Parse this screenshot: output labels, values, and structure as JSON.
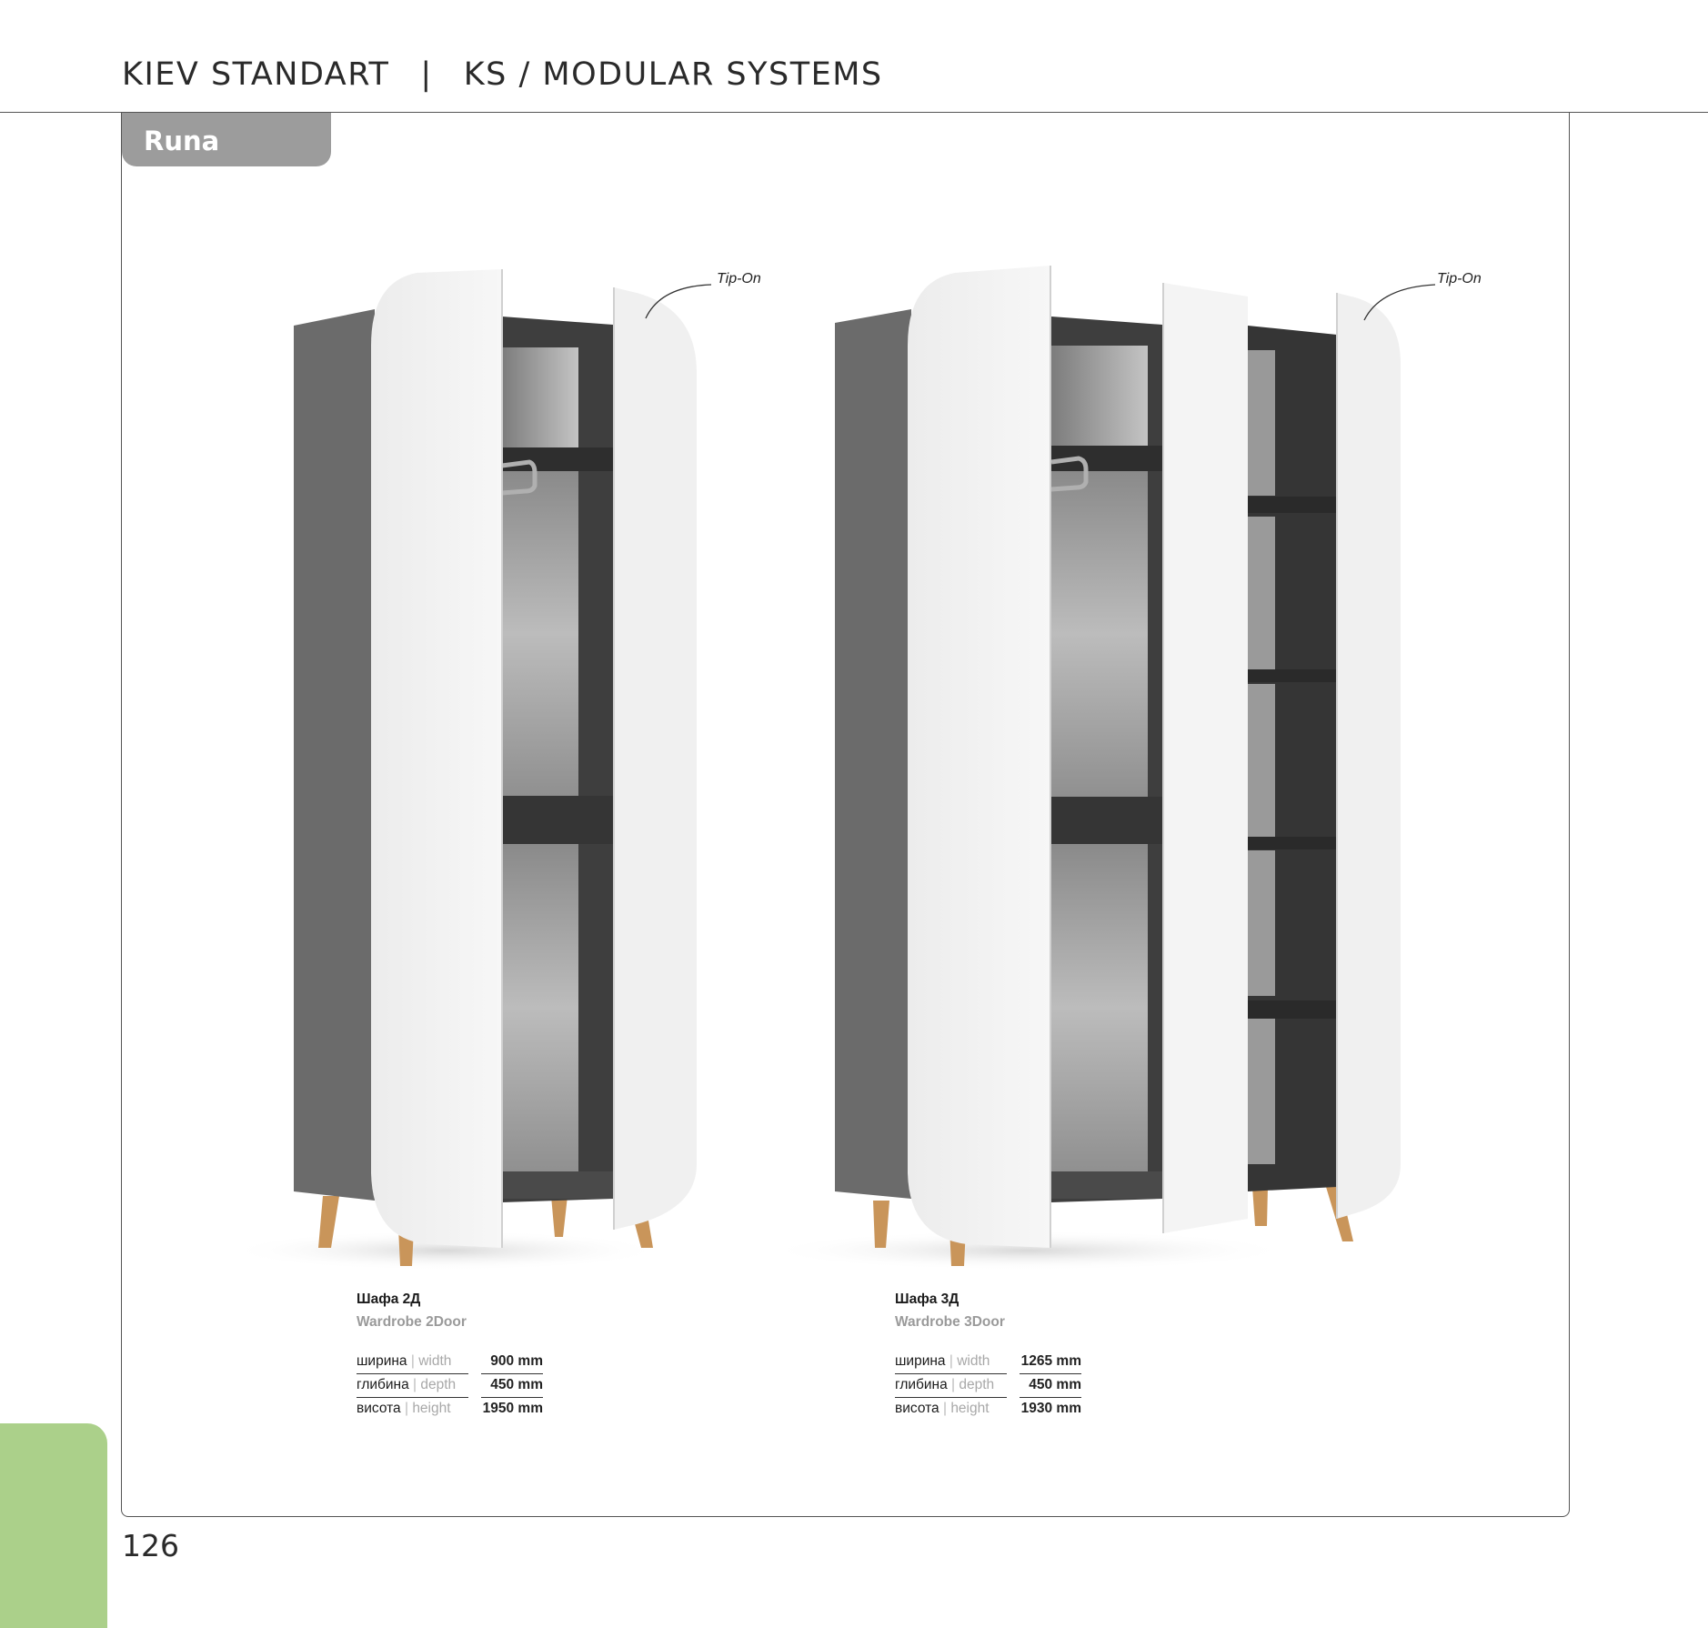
{
  "header": {
    "brand": "KIEV STANDART",
    "separator": "|",
    "section": "KS / MODULAR SYSTEMS"
  },
  "collection_tab": "Runa",
  "page_number": "126",
  "colors": {
    "tab_gray": "#9c9c9c",
    "accent_green": "#abd08a",
    "carcass": "#5a5a5a",
    "door_white": "#f2f2f2",
    "legs": "#c9955a"
  },
  "products": [
    {
      "name_uk": "Шафа 2Д",
      "name_en": "Wardrobe 2Door",
      "callout": "Tip-On",
      "specs": [
        {
          "label_uk": "ширина",
          "label_en": "width",
          "value": "900 mm"
        },
        {
          "label_uk": "глибина",
          "label_en": "depth",
          "value": "450 mm"
        },
        {
          "label_uk": "висота",
          "label_en": "height",
          "value": "1950 mm"
        }
      ]
    },
    {
      "name_uk": "Шафа 3Д",
      "name_en": "Wardrobe 3Door",
      "callout": "Tip-On",
      "specs": [
        {
          "label_uk": "ширина",
          "label_en": "width",
          "value": "1265 mm"
        },
        {
          "label_uk": "глибина",
          "label_en": "depth",
          "value": "450 mm"
        },
        {
          "label_uk": "висота",
          "label_en": "height",
          "value": "1930 mm"
        }
      ]
    }
  ]
}
